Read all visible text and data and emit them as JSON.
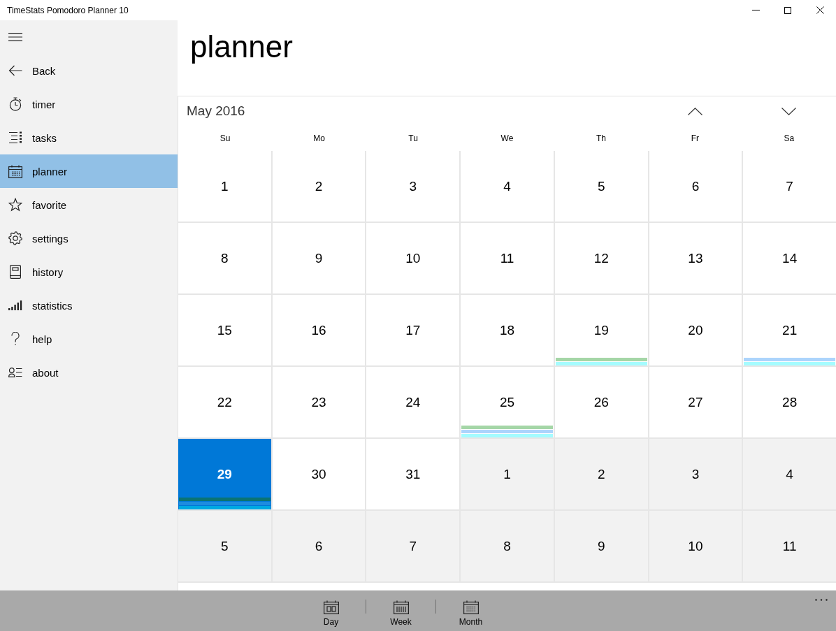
{
  "window": {
    "title": "TimeStats Pomodoro Planner 10"
  },
  "sidebar": {
    "items": [
      {
        "label": "Back",
        "selected": false
      },
      {
        "label": "timer",
        "selected": false
      },
      {
        "label": "tasks",
        "selected": false
      },
      {
        "label": "planner",
        "selected": true
      },
      {
        "label": "favorite",
        "selected": false
      },
      {
        "label": "settings",
        "selected": false
      },
      {
        "label": "history",
        "selected": false
      },
      {
        "label": "statistics",
        "selected": false
      },
      {
        "label": "help",
        "selected": false
      },
      {
        "label": "about",
        "selected": false
      }
    ]
  },
  "page": {
    "title": "planner"
  },
  "calendar": {
    "month": "May 2016",
    "weekdays": [
      "Su",
      "Mo",
      "Tu",
      "We",
      "Th",
      "Fr",
      "Sa"
    ],
    "weeks": [
      {
        "days": [
          {
            "day": "1",
            "outside_month": false,
            "selected": false
          },
          {
            "day": "2",
            "outside_month": false,
            "selected": false
          },
          {
            "day": "3",
            "outside_month": false,
            "selected": false
          },
          {
            "day": "4",
            "outside_month": false,
            "selected": false
          },
          {
            "day": "5",
            "outside_month": false,
            "selected": false
          },
          {
            "day": "6",
            "outside_month": false,
            "selected": false
          },
          {
            "day": "7",
            "outside_month": false,
            "selected": false
          }
        ]
      },
      {
        "days": [
          {
            "day": "8",
            "outside_month": false,
            "selected": false
          },
          {
            "day": "9",
            "outside_month": false,
            "selected": false
          },
          {
            "day": "10",
            "outside_month": false,
            "selected": false
          },
          {
            "day": "11",
            "outside_month": false,
            "selected": false
          },
          {
            "day": "12",
            "outside_month": false,
            "selected": false
          },
          {
            "day": "13",
            "outside_month": false,
            "selected": false
          },
          {
            "day": "14",
            "outside_month": false,
            "selected": false
          }
        ]
      },
      {
        "days": [
          {
            "day": "15",
            "outside_month": false,
            "selected": false
          },
          {
            "day": "16",
            "outside_month": false,
            "selected": false
          },
          {
            "day": "17",
            "outside_month": false,
            "selected": false
          },
          {
            "day": "18",
            "outside_month": false,
            "selected": false
          },
          {
            "day": "19",
            "outside_month": false,
            "selected": false,
            "events": [
              {
                "color": "#a5d6a7"
              },
              {
                "color": "#a5fcff"
              }
            ]
          },
          {
            "day": "20",
            "outside_month": false,
            "selected": false
          },
          {
            "day": "21",
            "outside_month": false,
            "selected": false,
            "events": [
              {
                "color": "#acd4fc"
              },
              {
                "color": "#a5fcff"
              }
            ]
          }
        ]
      },
      {
        "days": [
          {
            "day": "22",
            "outside_month": false,
            "selected": false
          },
          {
            "day": "23",
            "outside_month": false,
            "selected": false
          },
          {
            "day": "24",
            "outside_month": false,
            "selected": false
          },
          {
            "day": "25",
            "outside_month": false,
            "selected": false,
            "events": [
              {
                "color": "#a5d6a7"
              },
              {
                "color": "#acd4fc"
              },
              {
                "color": "#a5fcff"
              }
            ]
          },
          {
            "day": "26",
            "outside_month": false,
            "selected": false
          },
          {
            "day": "27",
            "outside_month": false,
            "selected": false
          },
          {
            "day": "28",
            "outside_month": false,
            "selected": false
          }
        ]
      },
      {
        "days": [
          {
            "day": "29",
            "outside_month": false,
            "selected": true,
            "events": [
              {
                "color": "#0a7474"
              },
              {
                "color": "#1e8ce0"
              },
              {
                "color": "#00a9e3"
              }
            ]
          },
          {
            "day": "30",
            "outside_month": false,
            "selected": false
          },
          {
            "day": "31",
            "outside_month": false,
            "selected": false
          },
          {
            "day": "1",
            "outside_month": true,
            "selected": false
          },
          {
            "day": "2",
            "outside_month": true,
            "selected": false
          },
          {
            "day": "3",
            "outside_month": true,
            "selected": false
          },
          {
            "day": "4",
            "outside_month": true,
            "selected": false
          }
        ]
      },
      {
        "days": [
          {
            "day": "5",
            "outside_month": true,
            "selected": false
          },
          {
            "day": "6",
            "outside_month": true,
            "selected": false
          },
          {
            "day": "7",
            "outside_month": true,
            "selected": false
          },
          {
            "day": "8",
            "outside_month": true,
            "selected": false
          },
          {
            "day": "9",
            "outside_month": true,
            "selected": false
          },
          {
            "day": "10",
            "outside_month": true,
            "selected": false
          },
          {
            "day": "11",
            "outside_month": true,
            "selected": false
          }
        ]
      }
    ]
  },
  "app_bar": {
    "buttons": [
      {
        "label": "Day"
      },
      {
        "label": "Week"
      },
      {
        "label": "Month"
      }
    ]
  }
}
